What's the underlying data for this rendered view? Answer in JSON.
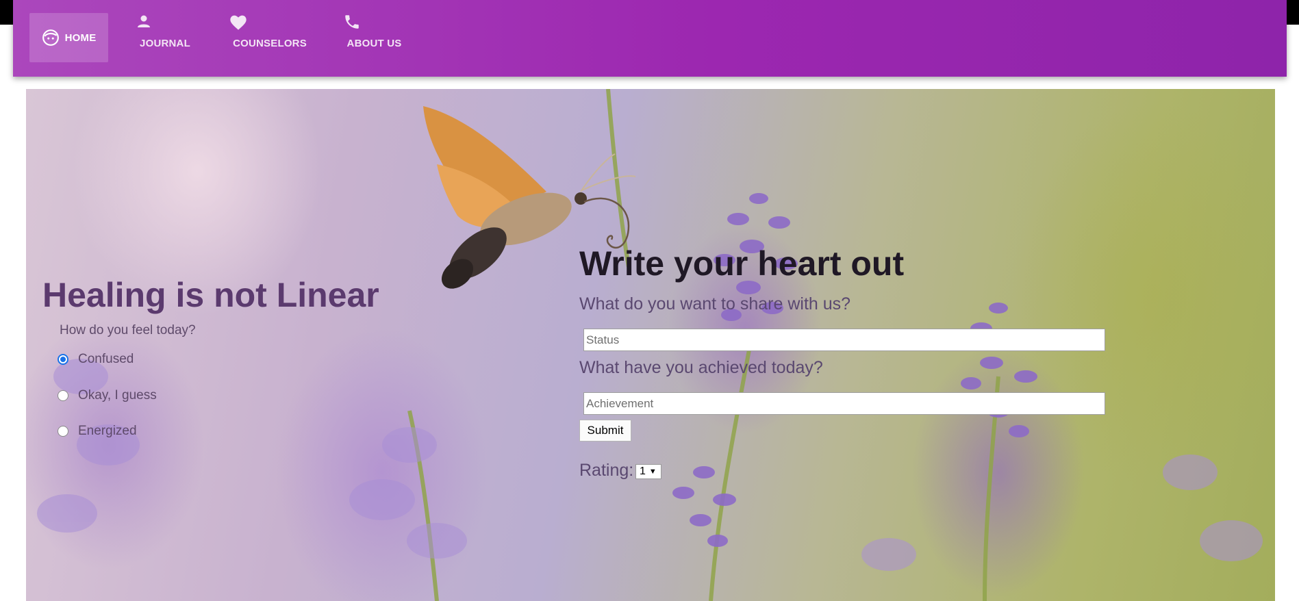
{
  "nav": {
    "items": [
      {
        "label": "HOME",
        "icon": "face-icon",
        "active": true
      },
      {
        "label": "JOURNAL",
        "icon": "person-icon",
        "active": false
      },
      {
        "label": "COUNSELORS",
        "icon": "heart-icon",
        "active": false
      },
      {
        "label": "ABOUT US",
        "icon": "phone-icon",
        "active": false
      }
    ]
  },
  "hero": {
    "background": "photo of a hummingbird hawk-moth hovering over lavender flowers"
  },
  "mood": {
    "title": "Healing is not Linear",
    "question": "How do you feel today?",
    "options": [
      {
        "label": "Confused",
        "checked": true
      },
      {
        "label": "Okay, I guess",
        "checked": false
      },
      {
        "label": "Energized",
        "checked": false
      }
    ]
  },
  "journal": {
    "title": "Write your heart out",
    "share_question": "What do you want to share with us?",
    "status_placeholder": "Status",
    "achieve_question": "What have you achieved today?",
    "achievement_placeholder": "Achievement",
    "submit_label": "Submit",
    "rating_label": "Rating:",
    "rating_value": "1"
  },
  "colors": {
    "nav_bg": "#9c27b0",
    "title_left": "#5b3a6e",
    "title_right": "#1f1825",
    "radio_accent": "#1a73e8"
  }
}
